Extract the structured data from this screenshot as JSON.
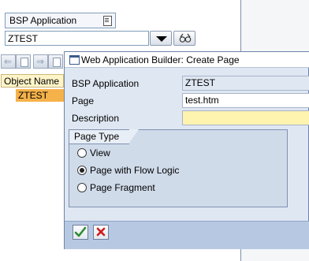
{
  "browser": {
    "object_type": "BSP Application",
    "object_name": "ZTEST",
    "column_header": "Object Name",
    "tree_item": "ZTEST"
  },
  "dialog": {
    "title": "Web Application Builder: Create Page",
    "fields": {
      "bsp_application": {
        "label": "BSP Application",
        "value": "ZTEST"
      },
      "page": {
        "label": "Page",
        "value": "test.htm"
      },
      "description": {
        "label": "Description",
        "value": ""
      }
    },
    "page_type": {
      "title": "Page Type",
      "options": [
        {
          "label": "View",
          "selected": false
        },
        {
          "label": "Page with Flow Logic",
          "selected": true
        },
        {
          "label": "Page Fragment",
          "selected": false
        }
      ]
    }
  },
  "icons": {
    "ok": "checkmark-icon",
    "cancel": "cancel-x-icon",
    "display": "dropdown-triangle-icon",
    "link": "glasses-icon"
  },
  "colors": {
    "ok_green": "#2e8b2e",
    "cancel_red": "#cc1f1f",
    "tree_selected": "#f5b24a",
    "required_field": "#fff3b0"
  }
}
